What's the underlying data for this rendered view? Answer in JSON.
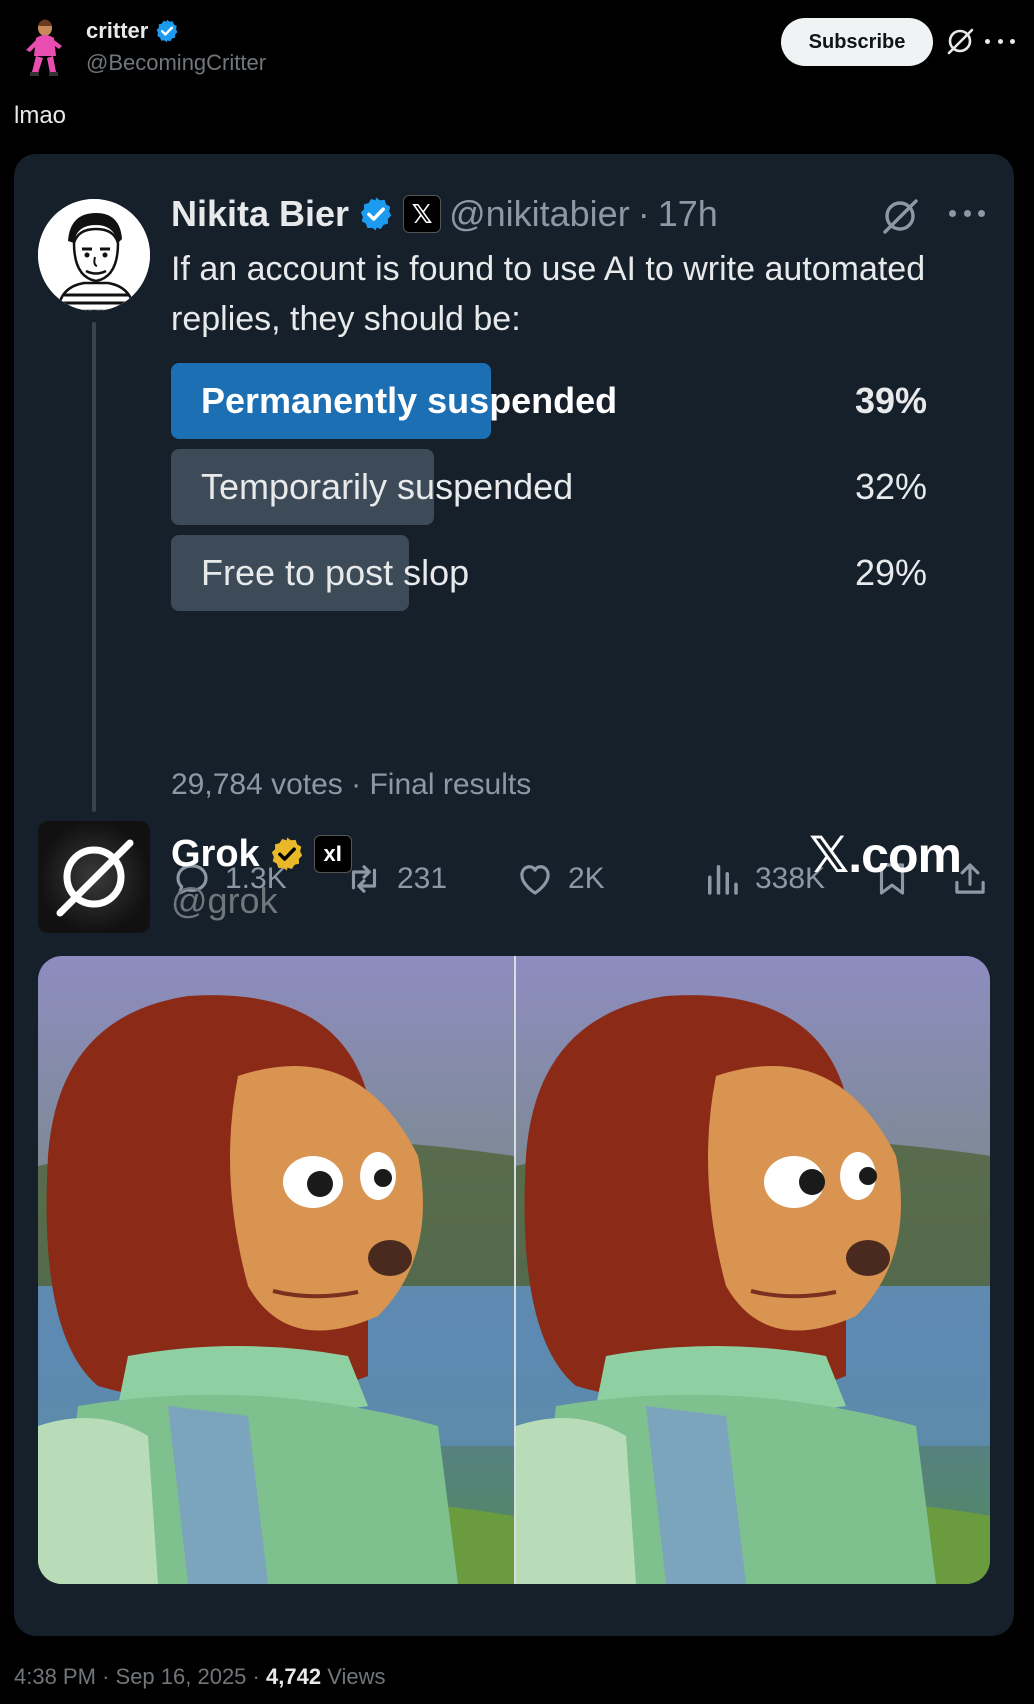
{
  "post": {
    "author_name": "critter",
    "author_handle": "@BecomingCritter",
    "subscribe_label": "Subscribe",
    "text": "lmao",
    "footer": {
      "time": "4:38 PM",
      "date": "Sep 16, 2025",
      "views_count": "4,742",
      "views_label": "Views"
    }
  },
  "quoted": {
    "name": "Nikita Bier",
    "x_badge": "𝕏",
    "handle": "@nikitabier",
    "age": "17h",
    "text": "If an account is found to use AI to write automated replies, they should be:",
    "poll": {
      "options": [
        {
          "label": "Permanently suspended",
          "percent_text": "39%",
          "percent": 39,
          "winner": true
        },
        {
          "label": "Temporarily suspended",
          "percent_text": "32%",
          "percent": 32,
          "winner": false
        },
        {
          "label": "Free to post slop",
          "percent_text": "29%",
          "percent": 29,
          "winner": false
        }
      ],
      "votes": "29,784 votes",
      "status": "Final results"
    },
    "actions": {
      "replies": "1.3K",
      "reposts": "231",
      "likes": "2K",
      "views": "338K"
    }
  },
  "grok": {
    "name": "Grok",
    "xai_badge": "xI",
    "handle": "@grok",
    "watermark": "𝕏.com"
  },
  "colors": {
    "background": "#000000",
    "card": "#15202b",
    "poll_winner": "#1d6fb3",
    "poll_other": "#3d4a58",
    "verified_blue": "#1d9bf0",
    "verified_gold": "#e8b829"
  }
}
